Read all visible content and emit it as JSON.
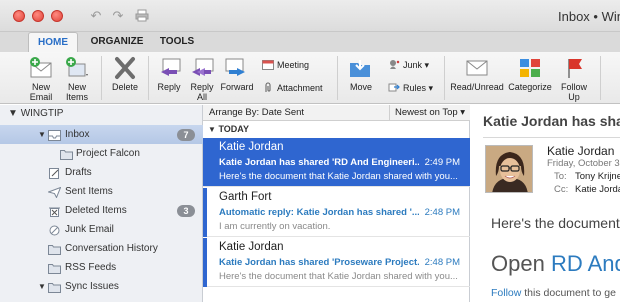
{
  "window": {
    "title": "Inbox • Wingt"
  },
  "tabs": [
    {
      "label": "HOME"
    },
    {
      "label": "ORGANIZE"
    },
    {
      "label": "TOOLS"
    }
  ],
  "ribbon": {
    "new_email": {
      "line1": "New",
      "line2": "Email"
    },
    "new_items": {
      "line1": "New",
      "line2": "Items"
    },
    "delete": "Delete",
    "reply": "Reply",
    "reply_all": {
      "line1": "Reply",
      "line2": "All"
    },
    "forward": "Forward",
    "meeting": "Meeting",
    "attachment": "Attachment",
    "move": "Move",
    "junk": "Junk",
    "rules": "Rules",
    "read_unread": "Read/Unread",
    "categorize": "Categorize",
    "follow_up": {
      "line1": "Follow",
      "line2": "Up"
    }
  },
  "folders": {
    "account": "WINGTIP",
    "items": [
      {
        "label": "Inbox",
        "count": "7"
      },
      {
        "label": "Project Falcon"
      },
      {
        "label": "Drafts"
      },
      {
        "label": "Sent Items"
      },
      {
        "label": "Deleted Items",
        "count": "3"
      },
      {
        "label": "Junk Email"
      },
      {
        "label": "Conversation History"
      },
      {
        "label": "RSS Feeds"
      },
      {
        "label": "Sync Issues"
      }
    ]
  },
  "list": {
    "arrange_by": "Arrange By: Date Sent",
    "order": "Newest on Top",
    "group": "TODAY",
    "messages": [
      {
        "from": "Katie Jordan",
        "subject": "Katie Jordan has shared 'RD And Engineeri...",
        "time": "2:49 PM",
        "preview": "Here's the document that Katie Jordan shared with you..."
      },
      {
        "from": "Garth Fort",
        "subject": "Automatic reply: Katie Jordan has shared '...",
        "time": "2:48 PM",
        "preview": "I am currently on vacation."
      },
      {
        "from": "Katie Jordan",
        "subject": "Katie Jordan has shared 'Proseware Project...",
        "time": "2:48 PM",
        "preview": "Here's the document that Katie Jordan shared with you..."
      }
    ]
  },
  "reading": {
    "subject": "Katie Jordan has sha",
    "sender": "Katie Jordan",
    "date": "Friday, October 3",
    "to_label": "To:",
    "to_value": "Tony Krijne",
    "cc_label": "Cc:",
    "cc_value": "Katie Jorda",
    "body_intro": "Here's the document",
    "big_prefix": "Open",
    "big_link": "RD And",
    "follow_link": "Follow",
    "follow_rest": "this document to ge"
  }
}
